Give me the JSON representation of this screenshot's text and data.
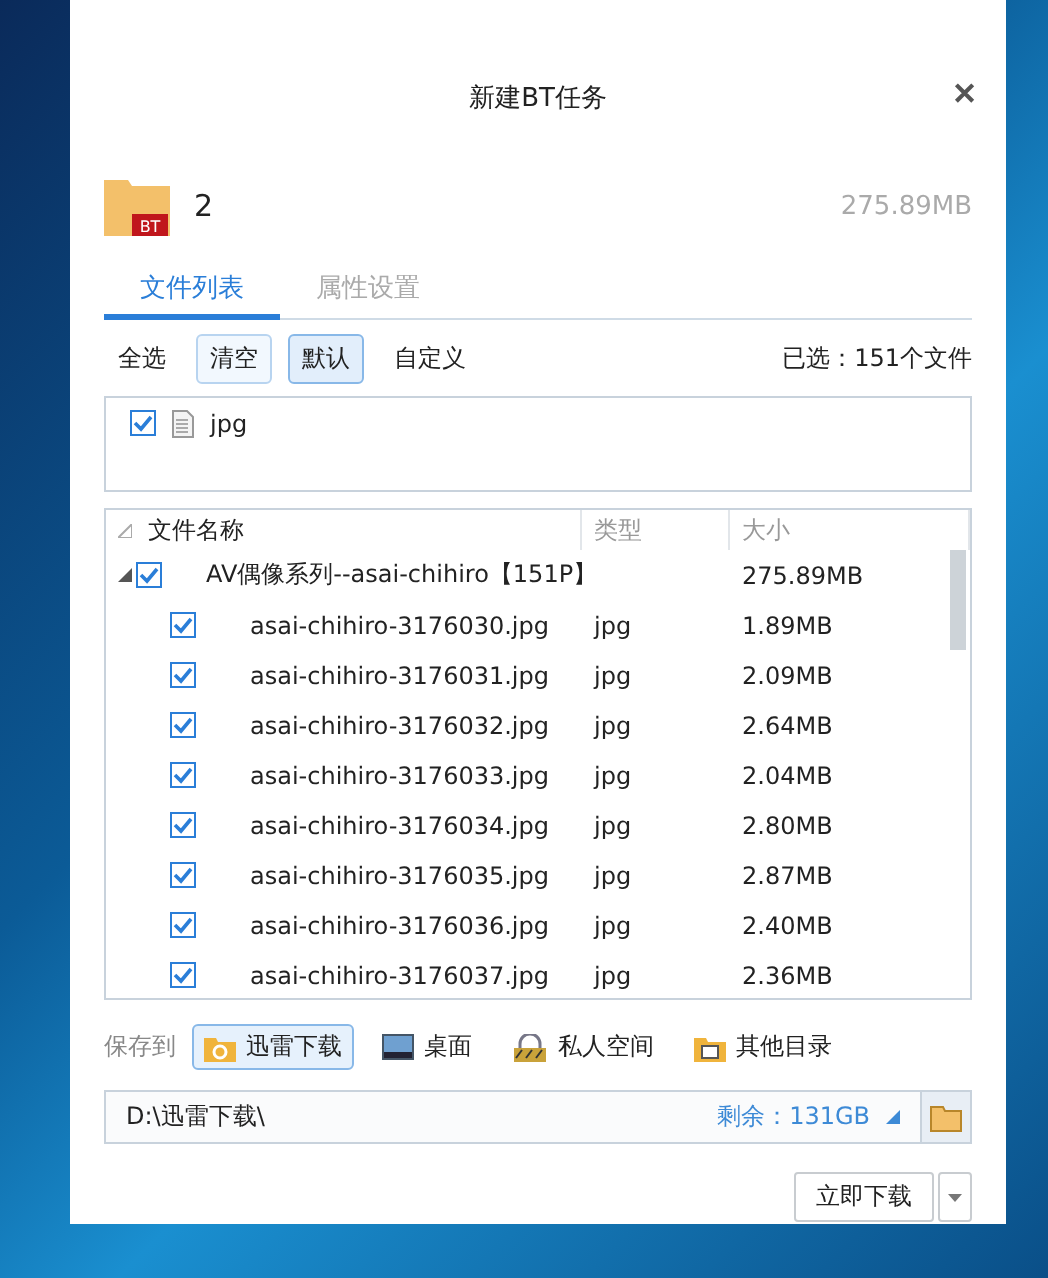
{
  "window": {
    "title": "新建BT任务",
    "close": "✕"
  },
  "task": {
    "badge": "BT",
    "name": "2",
    "size": "275.89MB"
  },
  "tabs": [
    {
      "label": "文件列表",
      "selected": true
    },
    {
      "label": "属性设置",
      "selected": false
    }
  ],
  "toolbar": {
    "buttons": [
      {
        "label": "全选",
        "selected": false,
        "hovered": false
      },
      {
        "label": "清空",
        "selected": false,
        "hovered": true
      },
      {
        "label": "默认",
        "selected": true,
        "hovered": false
      },
      {
        "label": "自定义",
        "selected": false,
        "hovered": false
      }
    ],
    "selected_count": "已选：151个文件"
  },
  "filters": [
    {
      "label": "jpg",
      "checked": true
    }
  ],
  "table": {
    "columns": [
      "文件名称",
      "类型",
      "大小"
    ],
    "folder": {
      "name": "AV偶像系列--asai-chihiro【151P】",
      "size": "275.89MB",
      "checked": true,
      "expanded": true
    },
    "rows": [
      {
        "name": "asai-chihiro-3176030.jpg",
        "type": "jpg",
        "size": "1.89MB",
        "checked": true
      },
      {
        "name": "asai-chihiro-3176031.jpg",
        "type": "jpg",
        "size": "2.09MB",
        "checked": true
      },
      {
        "name": "asai-chihiro-3176032.jpg",
        "type": "jpg",
        "size": "2.64MB",
        "checked": true
      },
      {
        "name": "asai-chihiro-3176033.jpg",
        "type": "jpg",
        "size": "2.04MB",
        "checked": true
      },
      {
        "name": "asai-chihiro-3176034.jpg",
        "type": "jpg",
        "size": "2.80MB",
        "checked": true
      },
      {
        "name": "asai-chihiro-3176035.jpg",
        "type": "jpg",
        "size": "2.87MB",
        "checked": true
      },
      {
        "name": "asai-chihiro-3176036.jpg",
        "type": "jpg",
        "size": "2.40MB",
        "checked": true
      },
      {
        "name": "asai-chihiro-3176037.jpg",
        "type": "jpg",
        "size": "2.36MB",
        "checked": true
      }
    ]
  },
  "save": {
    "label": "保存到",
    "locations": [
      {
        "kind": "thunder",
        "label": "迅雷下载",
        "selected": true
      },
      {
        "kind": "desktop",
        "label": "桌面",
        "selected": false
      },
      {
        "kind": "private",
        "label": "私人空间",
        "selected": false
      },
      {
        "kind": "other",
        "label": "其他目录",
        "selected": false
      }
    ],
    "path": "D:\\迅雷下载\\",
    "free": "剩余：131GB"
  },
  "download_button": "立即下载"
}
